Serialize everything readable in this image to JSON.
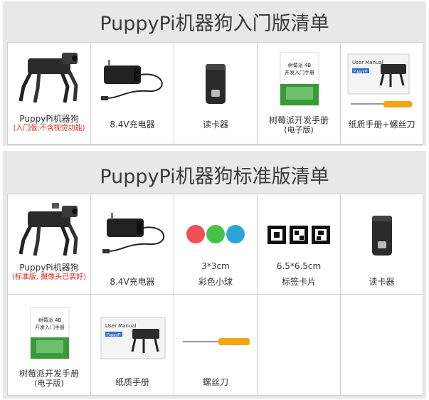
{
  "section1": {
    "title": "PuppyPi机器狗入门版清单",
    "items": [
      {
        "label": "PuppyPi机器狗",
        "note": "(入门版,不含视觉功能)"
      },
      {
        "label": "8.4V充电器"
      },
      {
        "label": "读卡器"
      },
      {
        "label": "树莓派开发手册",
        "note": "(电子版)"
      },
      {
        "label": "纸质手册+螺丝刀"
      }
    ]
  },
  "section2": {
    "title": "PuppyPi机器狗标准版清单",
    "items": [
      {
        "label": "PuppyPi机器狗",
        "note": "(标准版, 摄像头已装好)"
      },
      {
        "label": "8.4V充电器"
      },
      {
        "label": "彩色小球",
        "spec": "3*3cm"
      },
      {
        "label": "标签卡片",
        "spec": "6.5*6.5cm"
      },
      {
        "label": "读卡器"
      },
      {
        "label": "树莓派开发手册",
        "note": "(电子版)"
      },
      {
        "label": "纸质手册"
      },
      {
        "label": "螺丝刀"
      }
    ]
  },
  "book": {
    "line1": "树莓派 4B",
    "line2": "开发入门手册"
  },
  "manual": {
    "title": "User Manual",
    "brand": "PuppyPi"
  },
  "colors": {
    "ball_red": "#f0505a",
    "ball_green": "#45c24a",
    "ball_blue": "#2aa6d6",
    "screwdriver": "#f2a516",
    "book_green": "#3a9a3a"
  }
}
